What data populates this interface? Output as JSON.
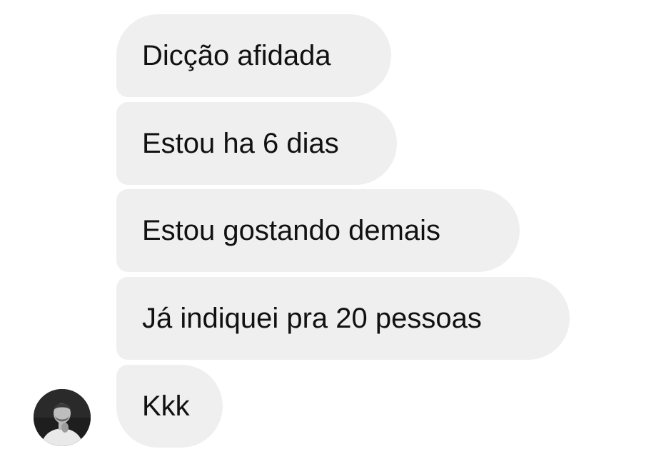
{
  "conversation": {
    "messages": [
      {
        "text": "Dicção afidada"
      },
      {
        "text": "Estou ha 6 dias"
      },
      {
        "text": "Estou gostando demais"
      },
      {
        "text": "Já indiquei pra 20 pessoas"
      },
      {
        "text": "Kkk"
      }
    ],
    "bubble_color": "#efefef",
    "text_color": "#111111"
  },
  "sender": {
    "avatar_icon": "profile-photo"
  }
}
